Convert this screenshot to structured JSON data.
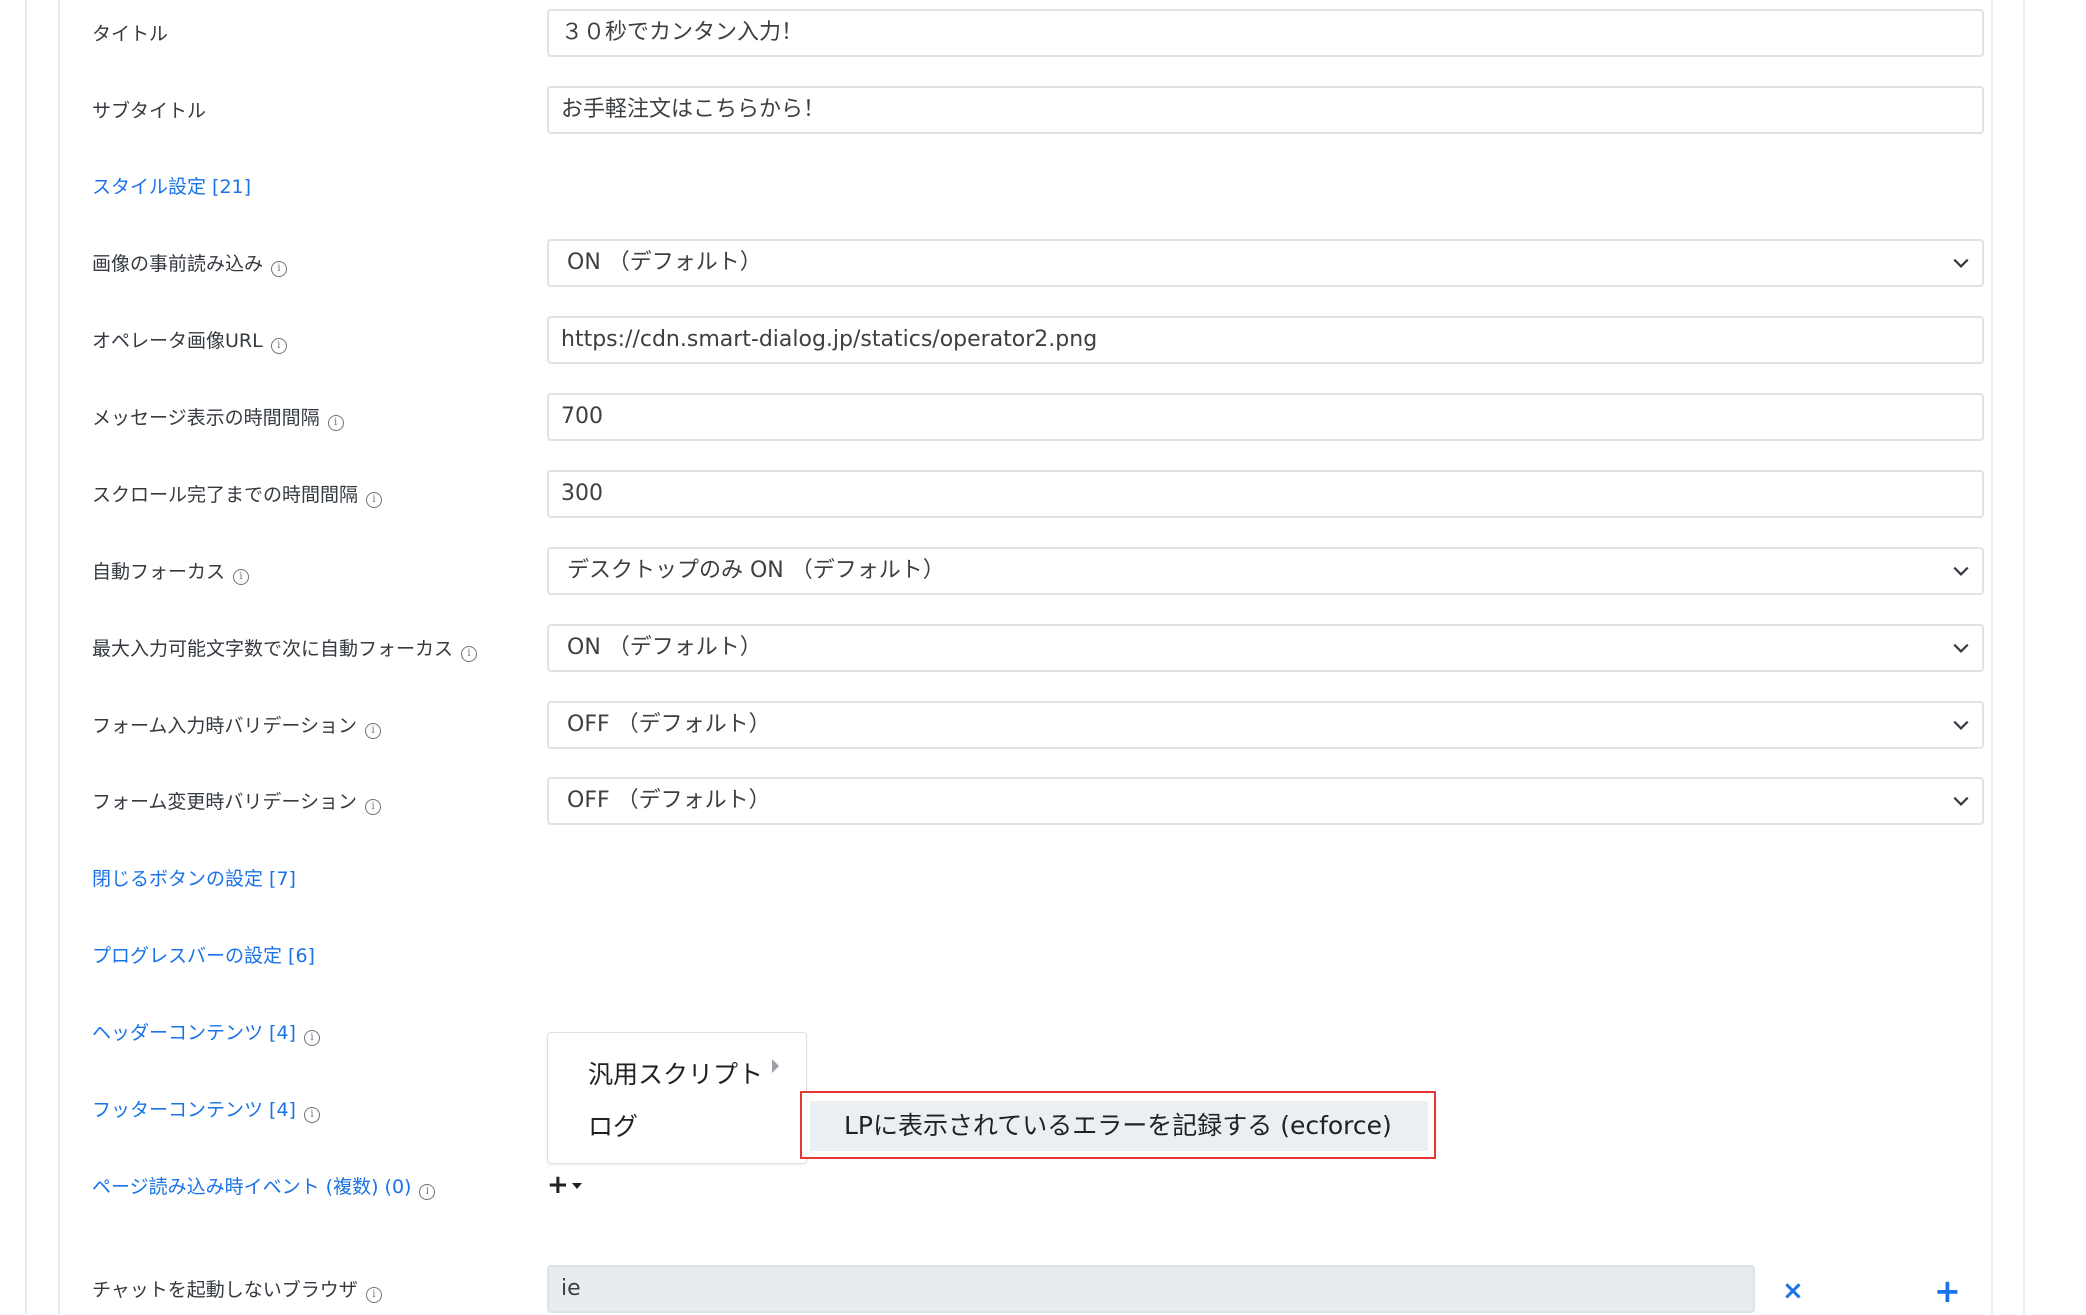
{
  "fields": {
    "title": {
      "label": "タイトル",
      "value": "３０秒でカンタン入力！"
    },
    "subtitle": {
      "label": "サブタイトル",
      "value": "お手軽注文はこちらから！"
    },
    "style_settings_link": "スタイル設定 [21]",
    "image_preload": {
      "label": "画像の事前読み込み",
      "value": "ON （デフォルト）"
    },
    "operator_image_url": {
      "label": "オペレータ画像URL",
      "value": "https://cdn.smart-dialog.jp/statics/operator2.png"
    },
    "message_interval": {
      "label": "メッセージ表示の時間間隔",
      "value": "700"
    },
    "scroll_interval": {
      "label": "スクロール完了までの時間間隔",
      "value": "300"
    },
    "auto_focus": {
      "label": "自動フォーカス",
      "value": "デスクトップのみ ON （デフォルト）"
    },
    "max_input_auto_focus": {
      "label": "最大入力可能文字数で次に自動フォーカス",
      "value": "ON （デフォルト）"
    },
    "input_validation": {
      "label": "フォーム入力時バリデーション",
      "value": "OFF （デフォルト）"
    },
    "change_validation": {
      "label": "フォーム変更時バリデーション",
      "value": "OFF （デフォルト）"
    },
    "close_button_link": "閉じるボタンの設定 [7]",
    "progress_bar_link": "プログレスバーの設定 [6]",
    "header_content_link": "ヘッダーコンテンツ [4]",
    "footer_content_link": "フッターコンテンツ [4]",
    "page_load_events_link": "ページ読み込み時イベント (複数) (0)",
    "excluded_browsers": {
      "label": "チャットを起動しないブラウザ",
      "value": "ie"
    }
  },
  "menu": {
    "items": [
      "汎用スクリプト",
      "ログ"
    ],
    "submenu_item": "LPに表示されているエラーを記録する (ecforce)"
  },
  "icons": {
    "info": "i",
    "add": "+",
    "remove": "×"
  }
}
